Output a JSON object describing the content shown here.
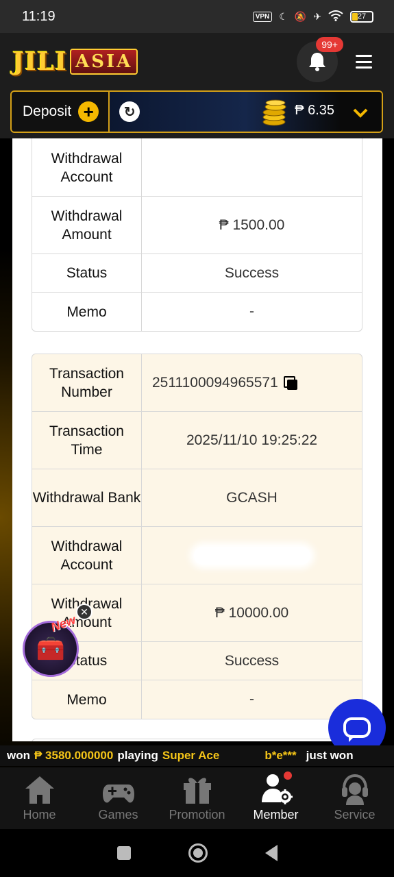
{
  "status_bar": {
    "time": "11:19",
    "vpn": "VPN",
    "battery": "27"
  },
  "header": {
    "logo_left": "JILI",
    "logo_right": "ASIA",
    "notification_badge": "99+",
    "icons": [
      "bell-icon",
      "menu-icon"
    ]
  },
  "wallet": {
    "deposit_label": "Deposit",
    "balance": "₱ 6.35"
  },
  "records": [
    {
      "rows": [
        {
          "label": "Withdrawal Account",
          "value": ""
        },
        {
          "label": "Withdrawal Amount",
          "value": "₱ 1500.00"
        },
        {
          "label": "Status",
          "value": "Success"
        },
        {
          "label": "Memo",
          "value": "-"
        }
      ]
    },
    {
      "rows": [
        {
          "label": "Transaction Number",
          "value": "2511100094965571"
        },
        {
          "label": "Transaction Time",
          "value": "2025/11/10 19:25:22"
        },
        {
          "label": "Withdrawal Bank",
          "value": "GCASH"
        },
        {
          "label": "Withdrawal Account",
          "value": ""
        },
        {
          "label": "Withdrawal Amount",
          "value": "₱ 10000.00"
        },
        {
          "label": "Status",
          "value": "Success"
        },
        {
          "label": "Memo",
          "value": "-"
        }
      ]
    }
  ],
  "ticker": {
    "won": "won",
    "amount": "₱ 3580.000000",
    "playing": "playing",
    "game": "Super Ace",
    "user": "b*e***",
    "just_won": "just won"
  },
  "nav": {
    "items": [
      {
        "label": "Home"
      },
      {
        "label": "Games"
      },
      {
        "label": "Promotion"
      },
      {
        "label": "Member"
      },
      {
        "label": "Service"
      }
    ]
  },
  "colors": {
    "gold": "#f5c518",
    "table_highlight": "#fdf6e7",
    "chat": "#1a2ddb"
  }
}
